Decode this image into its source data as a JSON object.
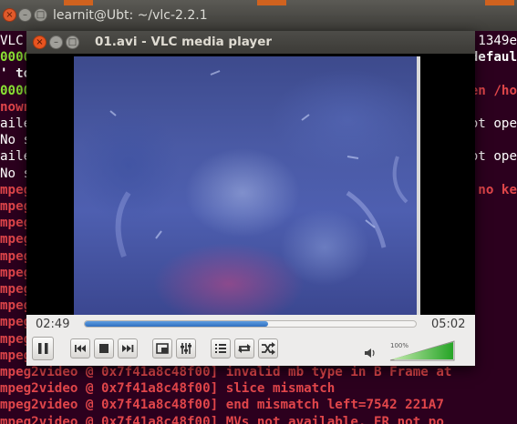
{
  "terminal": {
    "title": "learnit@Ubt: ~/vlc-2.2.1",
    "lines_left": [
      {
        "text": "VLC r",
        "cls": "white"
      },
      {
        "text": "00000",
        "cls": "green"
      },
      {
        "text": "' to",
        "cls": "whiteb"
      },
      {
        "text": "00000",
        "cls": "green"
      },
      {
        "text": "nown",
        "cls": "red"
      },
      {
        "text": "aile",
        "cls": "white"
      },
      {
        "text": "No s",
        "cls": "white"
      },
      {
        "text": "aile",
        "cls": "white"
      },
      {
        "text": "No s",
        "cls": "white"
      },
      {
        "text": "mpeg2",
        "cls": "red"
      },
      {
        "text": "mpeg2",
        "cls": "red"
      },
      {
        "text": "mpeg2",
        "cls": "red"
      },
      {
        "text": "mpeg2",
        "cls": "red"
      },
      {
        "text": "mpeg2",
        "cls": "red"
      },
      {
        "text": "mpeg2",
        "cls": "red"
      },
      {
        "text": "mpeg2",
        "cls": "red"
      },
      {
        "text": "mpeg2",
        "cls": "red"
      },
      {
        "text": "mpeg2",
        "cls": "red"
      },
      {
        "text": "mpeg2",
        "cls": "red"
      },
      {
        "text": "mpeg2",
        "cls": "red"
      },
      {
        "text": "mpeg2video @ 0x7f41a8c48f00] invalid mb type in B Frame at",
        "cls": "red"
      },
      {
        "text": "mpeg2video @ 0x7f41a8c48f00] slice mismatch",
        "cls": "red"
      },
      {
        "text": "mpeg2video @ 0x7f41a8c48f00] end mismatch left=7542 221A7",
        "cls": "red"
      },
      {
        "text": "mpeg2video @ 0x7f41a8c48f00] MVs not available, ER not po",
        "cls": "red"
      }
    ],
    "lines_right": [
      {
        "text": "1349e",
        "cls": "white"
      },
      {
        "text": "defaul",
        "cls": "whiteb"
      },
      {
        "text": "",
        "cls": "white"
      },
      {
        "text": "en /ho",
        "cls": "red"
      },
      {
        "text": "",
        "cls": "white"
      },
      {
        "text": "ot ope",
        "cls": "white"
      },
      {
        "text": "",
        "cls": "white"
      },
      {
        "text": "ot ope",
        "cls": "white"
      },
      {
        "text": "",
        "cls": "white"
      },
      {
        "text": "no ke",
        "cls": "red"
      }
    ]
  },
  "vlc": {
    "title": "01.avi - VLC media player",
    "elapsed": "02:49",
    "total": "05:02",
    "progress_fraction": 0.553,
    "volume_label": "100%",
    "volume_fraction": 1.0,
    "colors": {
      "accent": "#2f6fc0",
      "volume_green": "#2fa52f",
      "close_button": "#e95420"
    },
    "buttons": [
      "pause-icon",
      "previous-icon",
      "stop-icon",
      "next-icon",
      "fullscreen-icon",
      "extended-settings-icon",
      "playlist-icon",
      "loop-icon",
      "shuffle-icon"
    ]
  }
}
